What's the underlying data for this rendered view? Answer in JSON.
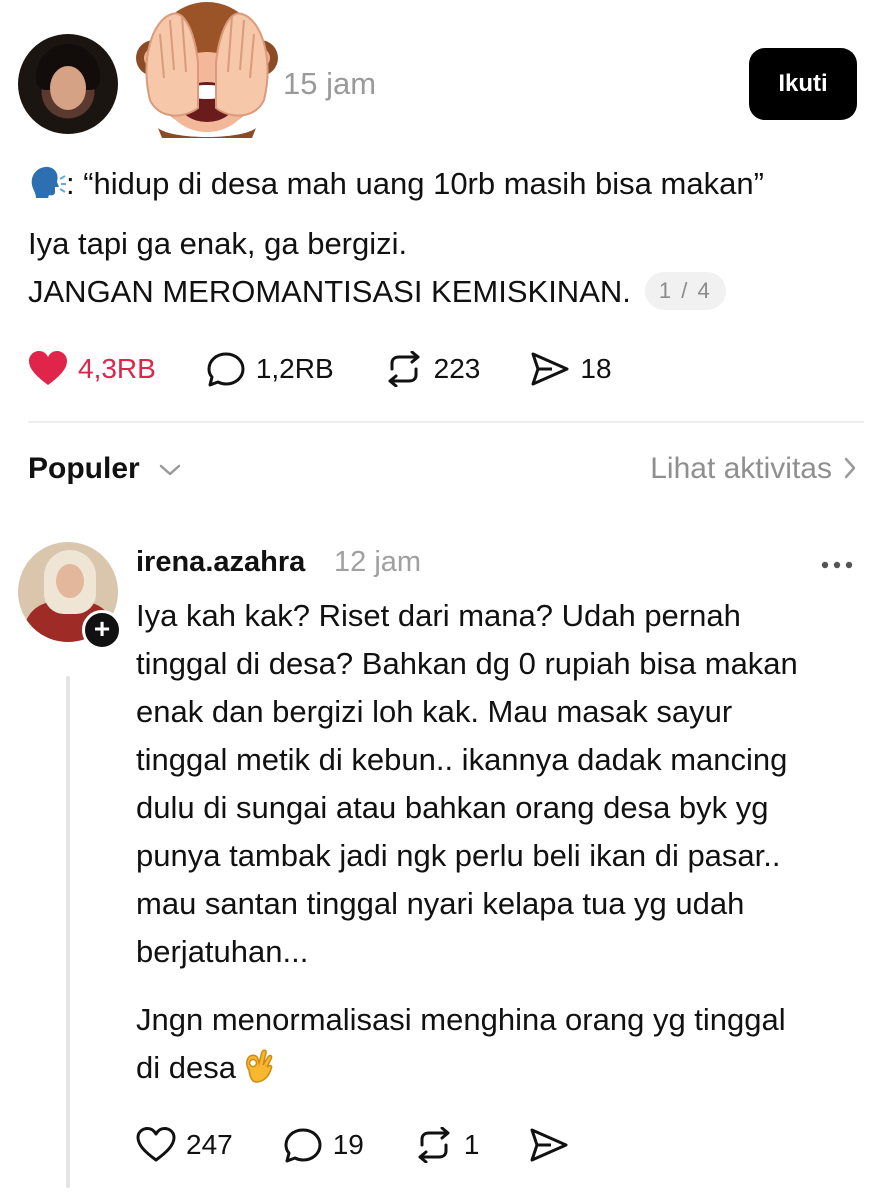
{
  "post": {
    "timestamp": "15 jam",
    "follow_label": "Ikuti",
    "text_lines": [
      ": “hidup di desa mah uang 10rb masih bisa makan”",
      "Iya tapi ga enak, ga bergizi.",
      "JANGAN MEROMANTISASI KEMISKINAN."
    ],
    "page_counter": "1 / 4",
    "stats": {
      "likes": "4,3RB",
      "replies": "1,2RB",
      "reposts": "223",
      "shares": "18"
    },
    "like_color": "#e0244a"
  },
  "sort": {
    "label": "Populer",
    "activity_link": "Lihat aktivitas"
  },
  "reply": {
    "username": "irena.azahra",
    "timestamp": "12 jam",
    "add_badge": "+",
    "paragraph1_lines": [
      "Iya kah kak? Riset dari mana? Udah pernah",
      "tinggal di desa? Bahkan dg 0 rupiah bisa makan",
      "enak dan bergizi loh kak. Mau masak sayur",
      "tinggal metik di kebun.. ikannya dadak mancing",
      "dulu di sungai atau bahkan orang desa byk yg",
      "punya tambak jadi ngk perlu beli ikan di pasar..",
      "mau santan tinggal nyari kelapa tua yg udah",
      "berjatuhan..."
    ],
    "paragraph2_lines": [
      "Jngn menormalisasi menghina orang yg tinggal",
      "di desa"
    ],
    "stats": {
      "likes": "247",
      "replies": "19",
      "reposts": "1"
    }
  },
  "icons": {
    "monkey": "see-no-evil-monkey-icon",
    "speaking_head": "speaking-head-icon",
    "ok_hand": "ok-hand-icon"
  }
}
